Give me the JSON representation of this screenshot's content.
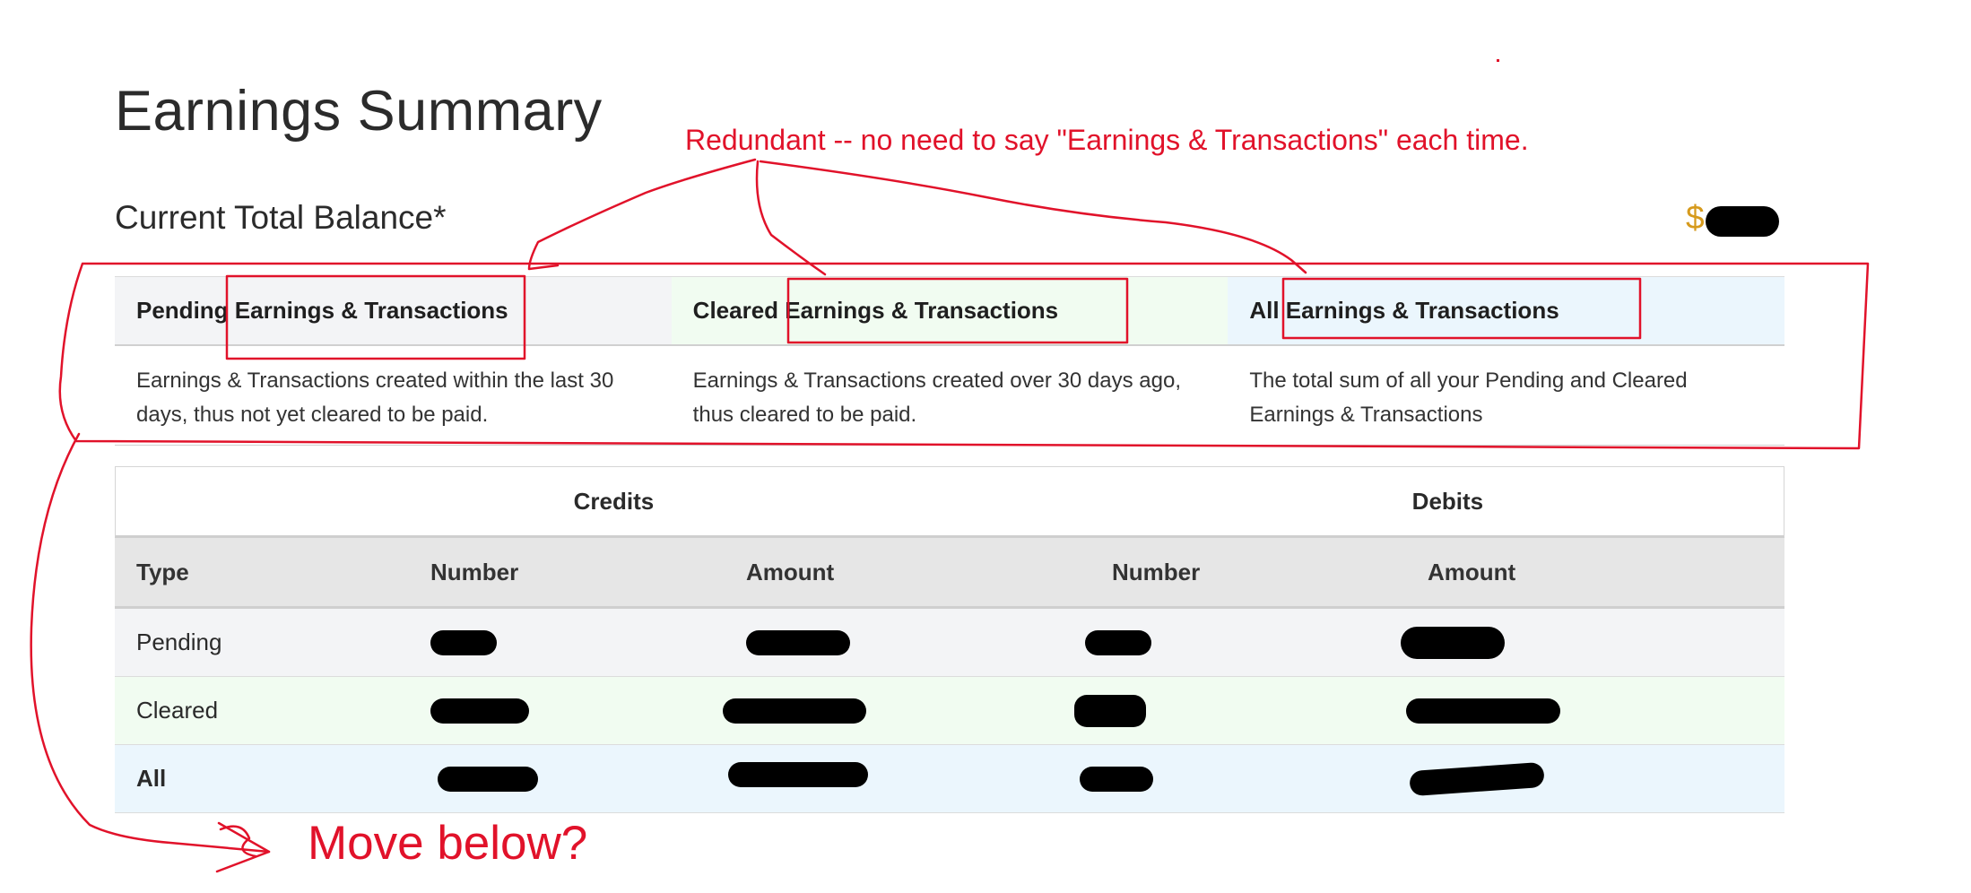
{
  "page": {
    "title": "Earnings Summary",
    "balance_label": "Current Total Balance*",
    "balance_amount_prefix": "$"
  },
  "definitions": {
    "headers": [
      "Pending Earnings & Transactions",
      "Cleared Earnings & Transactions",
      "All Earnings & Transactions"
    ],
    "descriptions": [
      "Earnings & Transactions created within the last 30 days, thus not yet cleared to be paid.",
      "Earnings & Transactions created over 30 days ago, thus cleared to be paid.",
      "The total sum of all your Pending and Cleared Earnings & Transactions"
    ]
  },
  "summary_table": {
    "groups": [
      "Credits",
      "Debits"
    ],
    "columns": [
      "Type",
      "Number",
      "Amount",
      "Number",
      "Amount"
    ],
    "rows": [
      {
        "type": "Pending"
      },
      {
        "type": "Cleared"
      },
      {
        "type": "All"
      }
    ]
  },
  "annotations": {
    "redundant_note": "Redundant -- no need to say \"Earnings & Transactions\" each time.",
    "move_note": "Move below?"
  },
  "colors": {
    "annotation_red": "#e1122a",
    "balance_gold": "#d69a1c",
    "pending_bg": "#f3f4f6",
    "cleared_bg": "#f1fcf1",
    "all_bg": "#ebf6fd"
  }
}
